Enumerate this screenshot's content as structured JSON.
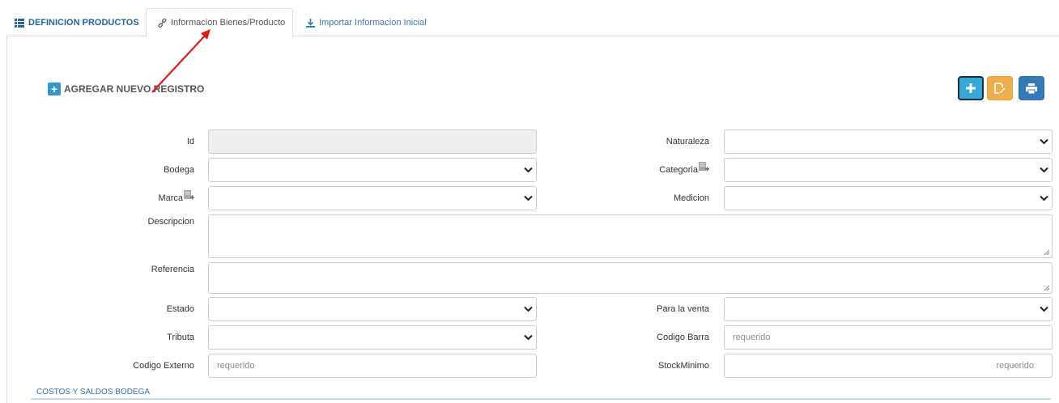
{
  "tabs": [
    {
      "label": "DEFINICION PRODUCTOS",
      "icon": "list-icon"
    },
    {
      "label": "Informacion Bienes/Producto",
      "icon": "link-icon",
      "active": true
    },
    {
      "label": "Importar Informacion Inicial",
      "icon": "download-icon"
    }
  ],
  "add_record_label": "AGREGAR NUEVO REGISTRO",
  "actions": {
    "new": "plus-icon",
    "save": "save-edit-icon",
    "print": "print-icon"
  },
  "colors": {
    "primary": "#3596c8",
    "warning": "#f0ad4e",
    "print": "#3479b8",
    "link": "#337ab7"
  },
  "form": {
    "id": {
      "label": "Id",
      "value": ""
    },
    "naturaleza": {
      "label": "Naturaleza",
      "value": ""
    },
    "bodega": {
      "label": "Bodega",
      "value": ""
    },
    "categoria": {
      "label": "Categoria",
      "value": ""
    },
    "marca": {
      "label": "Marca",
      "value": ""
    },
    "medicion": {
      "label": "Medicion",
      "value": ""
    },
    "descripcion": {
      "label": "Descripcion",
      "value": ""
    },
    "referencia": {
      "label": "Referencia",
      "value": ""
    },
    "estado": {
      "label": "Estado",
      "value": ""
    },
    "para_venta": {
      "label": "Para la venta",
      "value": ""
    },
    "tributa": {
      "label": "Tributa",
      "value": ""
    },
    "codigo_barra": {
      "label": "Codigo Barra",
      "placeholder": "requerido"
    },
    "codigo_externo": {
      "label": "Codigo Externo",
      "placeholder": "requerido"
    },
    "stock_minimo": {
      "label": "StockMinimo",
      "placeholder": "requerido"
    }
  },
  "section_title": "COSTOS Y SALDOS BODEGA"
}
